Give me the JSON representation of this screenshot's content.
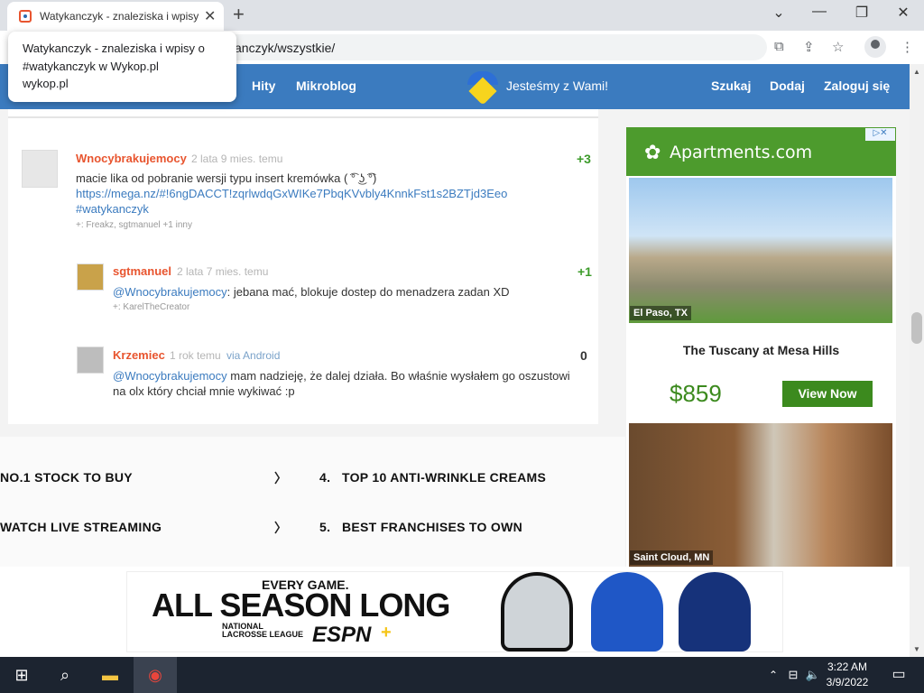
{
  "browser": {
    "tab_title": "Watykanczyk - znaleziska i wpisy",
    "new_tab": "+",
    "close_tab": "✕",
    "minimize": "⌄",
    "min_btn": "—",
    "max_btn": "❐",
    "close_btn": "✕",
    "url": "anczyk/wszystkie/",
    "tooltip_title": "Watykanczyk - znaleziska i wpisy o #watykanczyk w Wykop.pl",
    "tooltip_domain": "wykop.pl"
  },
  "site_nav": {
    "hits": "Hity",
    "microblog": "Mikroblog",
    "banner": "Jesteśmy z Wami!",
    "search": "Szukaj",
    "add": "Dodaj",
    "login": "Zaloguj się"
  },
  "comments": [
    {
      "user": "Wnocybrakujemocy",
      "time": "2 lata 9 mies. temu",
      "score": "+3",
      "line1": "macie lika od pobranie wersji typu insert kremówka ( ͡° ͜ʖ ͡°)",
      "line2": "https://mega.nz/#!6ngDACCT!zqrlwdqGxWIKe7PbqKVvbly4KnnkFst1s2BZTjd3Eeo",
      "line3": "#watykanczyk",
      "plus": "+: Freakz, sgtmanuel +1 inny"
    },
    {
      "user": "sgtmanuel",
      "time": "2 lata 7 mies. temu",
      "score": "+1",
      "mention": "@Wnocybrakujemocy",
      "text": ": jebana mać, blokuje dostep do menadzera zadan XD",
      "plus": "+: KarelTheCreator"
    },
    {
      "user": "Krzemiec",
      "time": "1 rok temu",
      "via": "via Android",
      "score": "0",
      "mention": "@Wnocybrakujemocy",
      "text": " mam nadzieję, że dalej działa. Bo właśnie wysłałem go oszustowi",
      "text2": "na olx który chciał mnie wykiwać :p"
    }
  ],
  "ad_list": {
    "item1": "NO.1 STOCK TO BUY",
    "item2": "WATCH LIVE STREAMING",
    "item4_num": "4.",
    "item4": "TOP 10 ANTI-WRINKLE CREAMS",
    "item5_num": "5.",
    "item5": "BEST FRANCHISES TO OWN"
  },
  "right_ad": {
    "brand": "Apartments.com",
    "loc1": "El Paso, TX",
    "property": "The Tuscany at Mesa Hills",
    "price": "$859",
    "cta": "View Now",
    "loc2": "Saint Cloud, MN"
  },
  "bottom_ad": {
    "line1": "EVERY GAME.",
    "line2": "ALL SEASON LONG",
    "league": "NATIONAL LACROSSE LEAGUE",
    "espn": "ESPN",
    "plus": "+"
  },
  "taskbar": {
    "time": "3:22 AM",
    "date": "3/9/2022"
  },
  "colors": {
    "nav": "#3b7bbf",
    "username": "#e8552f",
    "score_green": "#3c9b2a",
    "ad_green": "#3c8a1e"
  }
}
